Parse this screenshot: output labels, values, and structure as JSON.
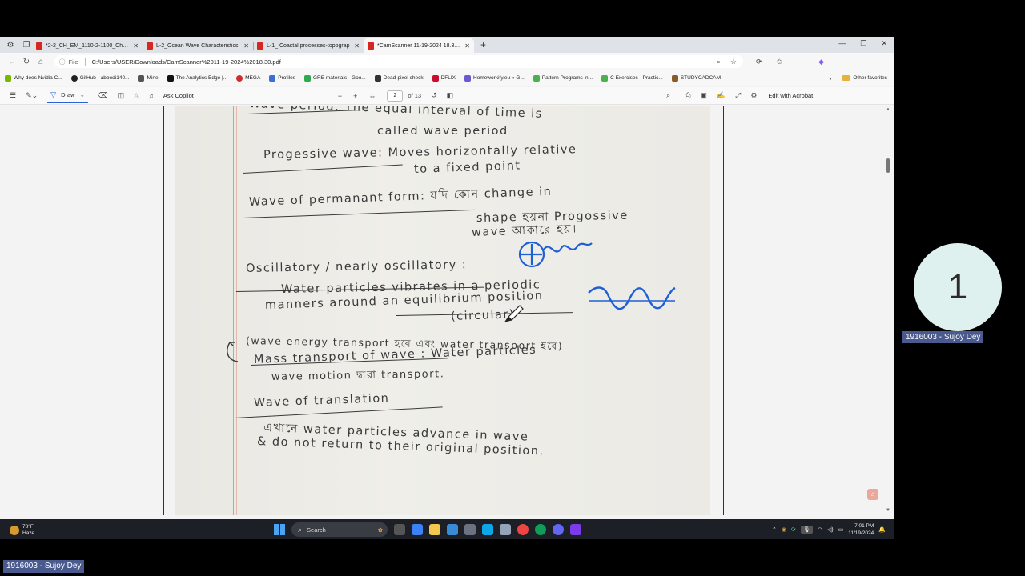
{
  "browser": {
    "tabs": [
      {
        "title": "*2-2_CH_EM_1110-2-1100_Ch_01",
        "active": false
      },
      {
        "title": "L-2_Ocean Wave Characteristics",
        "active": false
      },
      {
        "title": "L-1_ Coastal processes-topograp",
        "active": false
      },
      {
        "title": "*CamScanner 11-19-2024 18.30.p",
        "active": true
      }
    ],
    "address": {
      "file_label": "File",
      "url": "C:/Users/USER/Downloads/CamScanner%2011-19-2024%2018.30.pdf"
    },
    "bookmarks": [
      {
        "label": "Why does Nvidia C...",
        "color": "#76b900"
      },
      {
        "label": "GitHub - abbodi140...",
        "color": "#222222"
      },
      {
        "label": "Mine",
        "color": "#555555"
      },
      {
        "label": "The Analytics Edge |...",
        "color": "#111111"
      },
      {
        "label": "MEGA",
        "color": "#d9272e"
      },
      {
        "label": "Profiles",
        "color": "#3b6fd8"
      },
      {
        "label": "GRE materials - Goo...",
        "color": "#2fa84f"
      },
      {
        "label": "Dead-pixel check",
        "color": "#333333"
      },
      {
        "label": "DFLIX",
        "color": "#c8102e"
      },
      {
        "label": "Homeworkify.eu » G...",
        "color": "#6a5acd"
      },
      {
        "label": "Pattern Programs in...",
        "color": "#4caf50"
      },
      {
        "label": "C Exercises - Practic...",
        "color": "#4caf50"
      },
      {
        "label": "STUDYCADCAM",
        "color": "#8a5a2b"
      }
    ],
    "other_favorites": "Other favorites"
  },
  "pdf_toolbar": {
    "draw_label": "Draw",
    "ask_copilot": "Ask Copilot",
    "page_current": "2",
    "page_of": "of 13",
    "edit_acrobat": "Edit with Acrobat"
  },
  "notes": {
    "lines": [
      {
        "id": "l1",
        "text": "Wave period: The equal interval of time is"
      },
      {
        "id": "l2",
        "text": "called wave period"
      },
      {
        "id": "l3",
        "text": "Progessive wave: Moves horizontally relative"
      },
      {
        "id": "l4",
        "text": "to a fixed point"
      },
      {
        "id": "l5",
        "text": "Wave of permanant form: যদি কোন change in"
      },
      {
        "id": "l6",
        "text": "shape হয়না Progossive"
      },
      {
        "id": "l7",
        "text": "wave আকারে হয়।"
      },
      {
        "id": "l8",
        "text": "Oscillatory / nearly oscillatory :"
      },
      {
        "id": "l9",
        "text": "Water particles vibrates in a periodic"
      },
      {
        "id": "l10",
        "text": "manners around an equilibrium position"
      },
      {
        "id": "l11",
        "text": "(circular)"
      },
      {
        "id": "l12",
        "text": "(wave energy transport হবে এবং water transport হবে)"
      },
      {
        "id": "l13",
        "text": "Mass transport of wave : Water particles"
      },
      {
        "id": "l14",
        "text": "wave motion দ্বারা transport."
      },
      {
        "id": "l15",
        "text": "Wave of translation"
      },
      {
        "id": "l16",
        "text": "এখানে water particles advance in wave"
      },
      {
        "id": "l17",
        "text": "& do not return to their original position."
      }
    ],
    "ink_color": "#3a3a3a",
    "annotation_color": "#1f5fd6"
  },
  "taskbar": {
    "weather_temp": "78°F",
    "weather_desc": "Haze",
    "search_label": "Search",
    "time": "7:01 PM",
    "date": "11/19/2024"
  },
  "meeting": {
    "tile_number": "1",
    "tile_name": "1916003 - Sujoy Dey",
    "self_name": "1916003 - Sujoy Dey"
  }
}
